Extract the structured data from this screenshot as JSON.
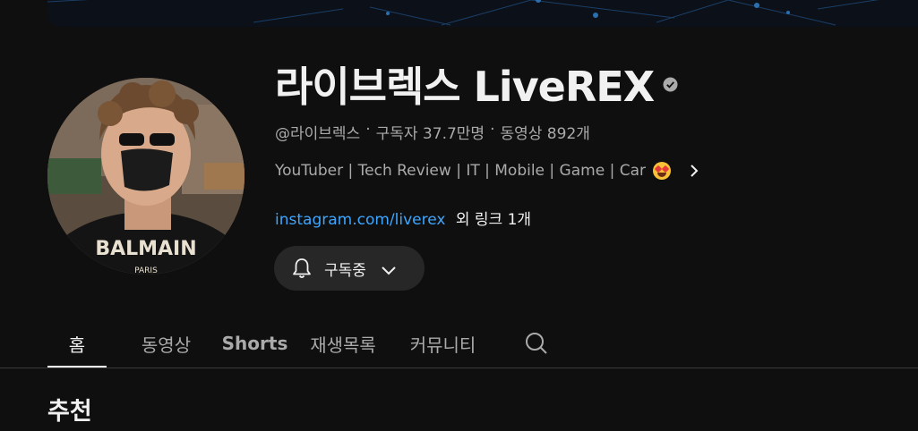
{
  "channel": {
    "name": "라이브렉스 LiveREX",
    "verified_icon": "verified-check-icon",
    "handle": "@라이브렉스",
    "separator": "·",
    "subscribers": "구독자 37.7만명",
    "videos": "동영상 892개",
    "description": "YouTuber | Tech Review | IT | Mobile | Game | Car",
    "description_emoji": "star-struck-emoji",
    "link": "instagram.com/liverex",
    "more_links": "외 링크 1개"
  },
  "subscribe_button": {
    "label": "구독중",
    "icon": "bell-icon"
  },
  "tabs": [
    {
      "label": "홈",
      "active": true
    },
    {
      "label": "동영상",
      "active": false
    },
    {
      "label": "Shorts",
      "active": false
    },
    {
      "label": "재생목록",
      "active": false
    },
    {
      "label": "커뮤니티",
      "active": false
    }
  ],
  "section": {
    "title": "추천"
  },
  "colors": {
    "background": "#0f0f0f",
    "link": "#3ea6ff",
    "button_bg": "#272727",
    "muted_text": "#aaaaaa"
  }
}
